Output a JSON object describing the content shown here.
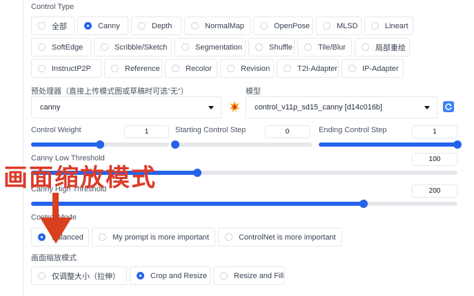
{
  "control_type": {
    "label": "Control Type",
    "rows": [
      [
        {
          "label": "全部",
          "selected": false
        },
        {
          "label": "Canny",
          "selected": true
        },
        {
          "label": "Depth",
          "selected": false
        },
        {
          "label": "NormalMap",
          "selected": false
        },
        {
          "label": "OpenPose",
          "selected": false
        },
        {
          "label": "MLSD",
          "selected": false
        },
        {
          "label": "Lineart",
          "selected": false
        }
      ],
      [
        {
          "label": "SoftEdge",
          "selected": false
        },
        {
          "label": "Scribble/Sketch",
          "selected": false
        },
        {
          "label": "Segmentation",
          "selected": false
        },
        {
          "label": "Shuffle",
          "selected": false
        },
        {
          "label": "Tile/Blur",
          "selected": false
        },
        {
          "label": "局部重绘",
          "selected": false
        }
      ],
      [
        {
          "label": "InstructP2P",
          "selected": false
        },
        {
          "label": "Reference",
          "selected": false
        },
        {
          "label": "Recolor",
          "selected": false
        },
        {
          "label": "Revision",
          "selected": false
        },
        {
          "label": "T2I-Adapter",
          "selected": false
        },
        {
          "label": "IP-Adapter",
          "selected": false
        }
      ]
    ]
  },
  "preprocessor": {
    "label": "预处理器（直接上传模式图或草稿时可选\"无\"）",
    "value": "canny"
  },
  "model": {
    "label": "模型",
    "value": "control_v11p_sd15_canny [d14c016b]"
  },
  "icons": {
    "run_preprocessor": "explosion-icon",
    "refresh": "refresh-icon"
  },
  "sliders": {
    "control_weight": {
      "label": "Control Weight",
      "value": "1",
      "fraction": 0.5
    },
    "starting_step": {
      "label": "Starting Control Step",
      "value": "0",
      "fraction": 0.0
    },
    "ending_step": {
      "label": "Ending Control Step",
      "value": "1",
      "fraction": 1.0
    },
    "low_threshold": {
      "label": "Canny Low Threshold",
      "value": "100",
      "fraction": 0.39
    },
    "high_threshold": {
      "label": "Canny High Threshold",
      "value": "200",
      "fraction": 0.78
    }
  },
  "control_mode": {
    "label": "Control Mode",
    "options": [
      {
        "label": "Balanced",
        "selected": true
      },
      {
        "label": "My prompt is more important",
        "selected": false
      },
      {
        "label": "ControlNet is more important",
        "selected": false
      }
    ]
  },
  "resize_mode": {
    "label": "画面缩放模式",
    "options": [
      {
        "label": "仅调整大小（拉伸）",
        "selected": false
      },
      {
        "label": "Crop and Resize",
        "selected": true
      },
      {
        "label": "Resize and Fill",
        "selected": false
      }
    ]
  },
  "annotation": {
    "text": "画面缩放模式",
    "color": "#dc3b2a"
  },
  "colors": {
    "accent": "#2563eb",
    "annotation": "#dc3b2a"
  }
}
